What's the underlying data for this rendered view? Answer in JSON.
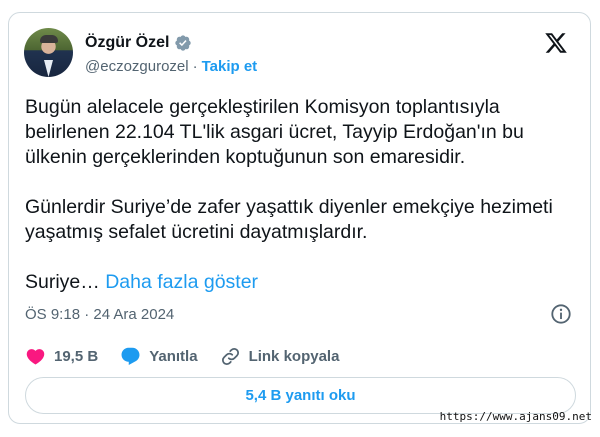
{
  "author": {
    "name": "Özgür Özel",
    "handle": "@eczozgurozel",
    "separator": "·",
    "follow_label": "Takip et"
  },
  "tweet": {
    "paragraph1": "Bugün alelacele gerçekleştirilen Komisyon toplantısıyla belirlenen 22.104 TL'lik asgari ücret, Tayyip Erdoğan'ın bu ülkenin gerçeklerinden koptuğunun son emaresidir.",
    "paragraph2": "Günlerdir Suriye’de zafer yaşattık diyenler emekçiye hezimeti yaşatmış sefalet ücretini dayatmışlardır.",
    "truncated": "Suriye…",
    "show_more": "Daha fazla göster"
  },
  "meta": {
    "time_date": "ÖS 9:18 · 24 Ara 2024"
  },
  "actions": {
    "likes": "19,5 B",
    "reply_label": "Yanıtla",
    "copy_link_label": "Link kopyala"
  },
  "read_replies_label": "5,4 B yanıtı oku",
  "watermark": "https://www.ajans09.net",
  "colors": {
    "accent": "#1d9bf0",
    "like": "#f91880",
    "text": "#0f1419",
    "muted": "#536471",
    "border": "#cfd9de"
  },
  "icons": [
    "verified-badge-icon",
    "x-logo-icon",
    "info-icon",
    "heart-icon",
    "reply-bubble-icon",
    "link-icon"
  ]
}
